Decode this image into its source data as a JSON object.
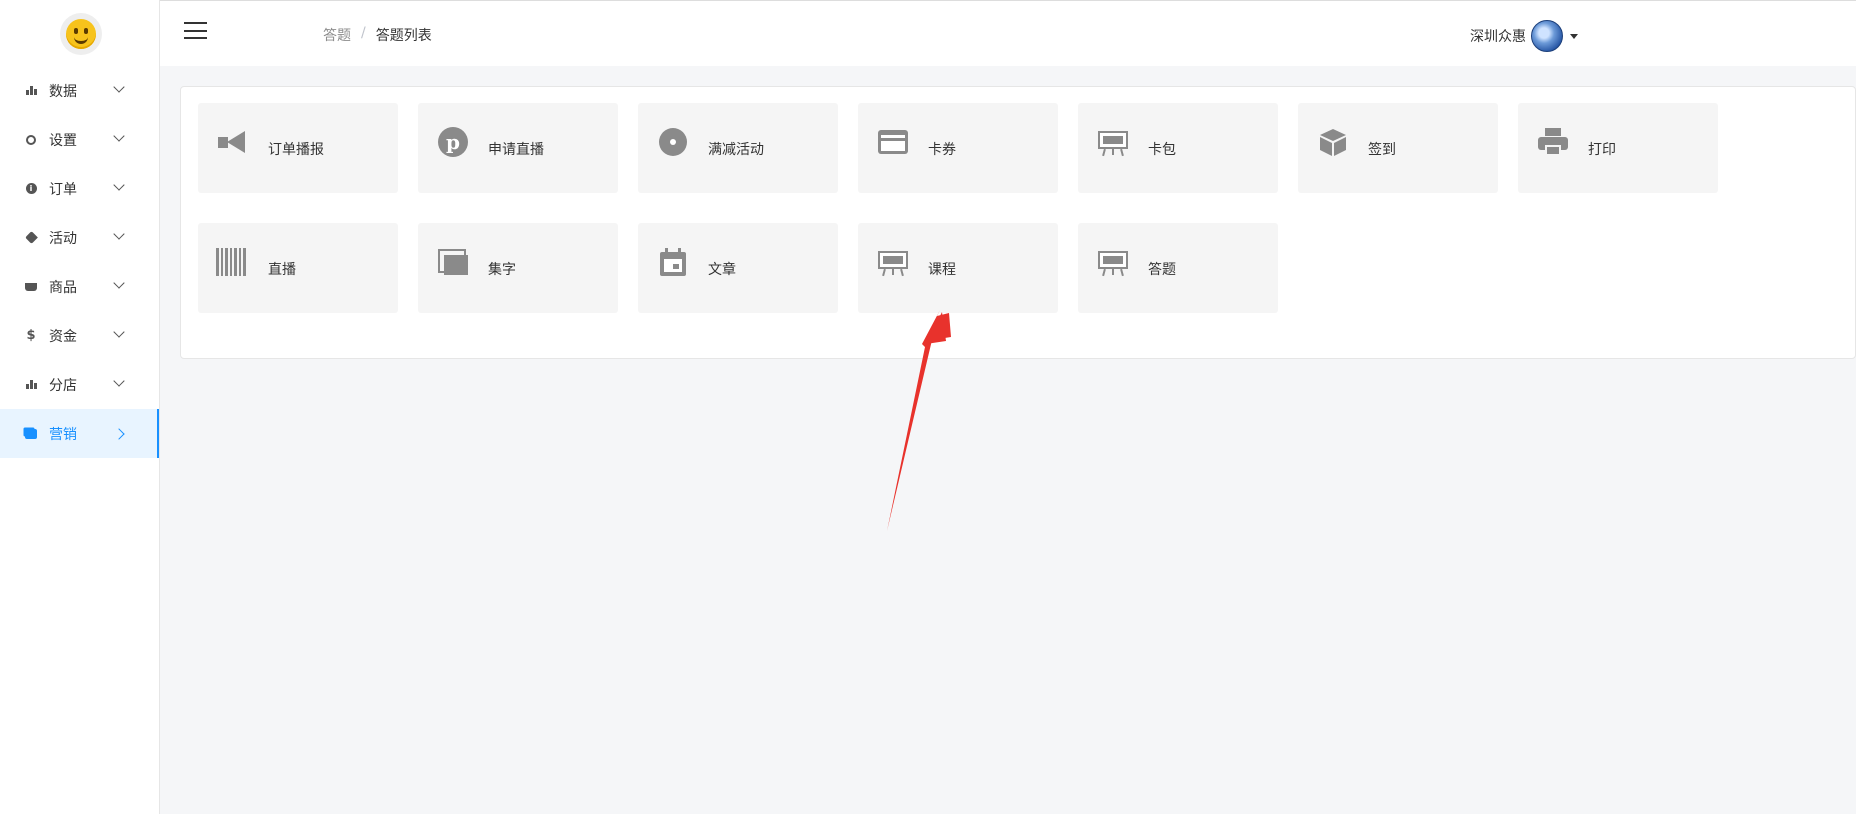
{
  "sidebar": {
    "logo_icon": "smiley-logo-icon",
    "items": [
      {
        "label": "数据",
        "icon": "bar-chart-icon"
      },
      {
        "label": "设置",
        "icon": "gear-icon"
      },
      {
        "label": "订单",
        "icon": "info-icon"
      },
      {
        "label": "活动",
        "icon": "tag-icon"
      },
      {
        "label": "商品",
        "icon": "basket-icon"
      },
      {
        "label": "资金",
        "icon": "dollar-icon"
      },
      {
        "label": "分店",
        "icon": "bar-chart-icon"
      },
      {
        "label": "营销",
        "icon": "stack-icon",
        "active": true
      }
    ]
  },
  "header": {
    "menu_icon": "hamburger-icon",
    "breadcrumb": {
      "first": "答题",
      "separator": "/",
      "current": "答题列表"
    },
    "user": {
      "name": "深圳众惠",
      "avatar_icon": "avatar-icon",
      "caret_icon": "caret-down-icon"
    }
  },
  "cards": [
    {
      "label": "订单播报",
      "icon": "megaphone-icon"
    },
    {
      "label": "申请直播",
      "icon": "pinterest-icon"
    },
    {
      "label": "满减活动",
      "icon": "disc-icon"
    },
    {
      "label": "卡券",
      "icon": "credit-card-icon"
    },
    {
      "label": "卡包",
      "icon": "easel-icon"
    },
    {
      "label": "签到",
      "icon": "cube-icon"
    },
    {
      "label": "打印",
      "icon": "printer-icon"
    },
    {
      "label": "直播",
      "icon": "barcode-icon"
    },
    {
      "label": "集字",
      "icon": "layers-icon"
    },
    {
      "label": "文章",
      "icon": "calendar-icon"
    },
    {
      "label": "课程",
      "icon": "easel-icon"
    },
    {
      "label": "答题",
      "icon": "easel-icon"
    }
  ],
  "colors": {
    "accent": "#1890ff",
    "active_bg": "#e8f4ff",
    "card_bg": "#f5f5f5",
    "icon_gray": "#8a8a8a",
    "page_bg": "#f5f6f8",
    "annotation_arrow": "#e8322c"
  }
}
